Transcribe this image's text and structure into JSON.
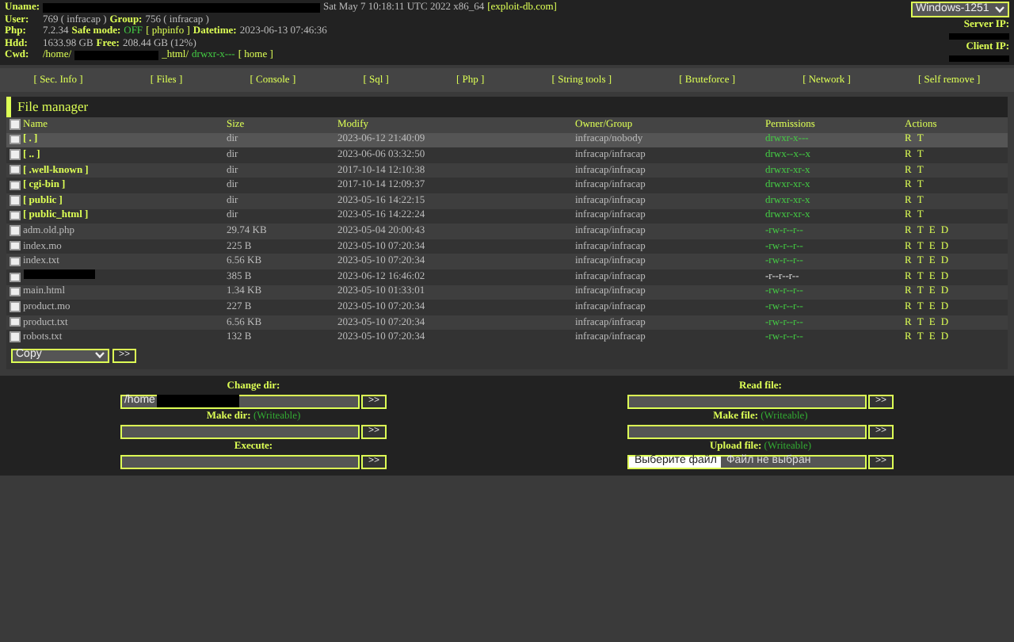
{
  "header": {
    "lines": [
      {
        "label": "Uname:",
        "parts": [
          {
            "kind": "redacted"
          },
          {
            "kind": "text",
            "text": "Sat May 7 10:18:11 UTC 2022 x86_64"
          },
          {
            "kind": "link",
            "text": "[exploit-db.com]"
          }
        ]
      },
      {
        "label": "User:",
        "parts": [
          {
            "kind": "text",
            "text": "769 ( infracap )"
          },
          {
            "kind": "label",
            "text": "Group:"
          },
          {
            "kind": "text",
            "text": "756 ( infracap )"
          }
        ]
      },
      {
        "label": "Php:",
        "parts": [
          {
            "kind": "text",
            "text": "7.2.34"
          },
          {
            "kind": "label",
            "text": "Safe mode:"
          },
          {
            "kind": "ok",
            "text": "OFF"
          },
          {
            "kind": "link",
            "text": "[ phpinfo ]"
          },
          {
            "kind": "label",
            "text": "Datetime:"
          },
          {
            "kind": "text",
            "text": "2023-06-13 07:46:36"
          }
        ]
      },
      {
        "label": "Hdd:",
        "parts": [
          {
            "kind": "text",
            "text": "1633.98 GB"
          },
          {
            "kind": "label",
            "text": "Free:"
          },
          {
            "kind": "text",
            "text": "208.44 GB (12%)"
          }
        ]
      },
      {
        "label": "Cwd:",
        "parts": [
          {
            "kind": "link",
            "text": "/home/"
          },
          {
            "kind": "redacted"
          },
          {
            "kind": "link",
            "text": "_html/"
          },
          {
            "kind": "ok",
            "text": "drwxr-x---"
          },
          {
            "kind": "link",
            "text": "[ home ]"
          }
        ]
      }
    ],
    "charset": "Windows-1251",
    "server_ip_label": "Server IP:",
    "client_ip_label": "Client IP:"
  },
  "nav": [
    "[ Sec. Info ]",
    "[ Files ]",
    "[ Console ]",
    "[ Sql ]",
    "[ Php ]",
    "[ String tools ]",
    "[ Bruteforce ]",
    "[ Network ]",
    "[ Self remove ]"
  ],
  "file_manager": {
    "title": "File manager",
    "select_all_checked": false,
    "columns": [
      "Name",
      "Size",
      "Modify",
      "Owner/Group",
      "Permissions",
      "Actions"
    ],
    "rows": [
      {
        "kind": "dir",
        "name": "[ . ]",
        "size": "dir",
        "modify": "2023-06-12 21:40:09",
        "owner": "infracap/nobody",
        "perms": "drwxr-x---",
        "writable": true,
        "actions": "R T",
        "checked": false,
        "highlighted": true
      },
      {
        "kind": "dir",
        "name": "[ .. ]",
        "size": "dir",
        "modify": "2023-06-06 03:32:50",
        "owner": "infracap/infracap",
        "perms": "drwx--x--x",
        "writable": true,
        "actions": "R T",
        "checked": false,
        "highlighted": false
      },
      {
        "kind": "dir",
        "name": "[ .well-known ]",
        "size": "dir",
        "modify": "2017-10-14 12:10:38",
        "owner": "infracap/infracap",
        "perms": "drwxr-xr-x",
        "writable": true,
        "actions": "R T",
        "checked": false,
        "highlighted": false
      },
      {
        "kind": "dir",
        "name": "[ cgi-bin ]",
        "size": "dir",
        "modify": "2017-10-14 12:09:37",
        "owner": "infracap/infracap",
        "perms": "drwxr-xr-x",
        "writable": true,
        "actions": "R T",
        "checked": false,
        "highlighted": false
      },
      {
        "kind": "dir",
        "name": "[ public ]",
        "size": "dir",
        "modify": "2023-05-16 14:22:15",
        "owner": "infracap/infracap",
        "perms": "drwxr-xr-x",
        "writable": true,
        "actions": "R T",
        "checked": false,
        "highlighted": false
      },
      {
        "kind": "dir",
        "name": "[ public_html ]",
        "size": "dir",
        "modify": "2023-05-16 14:22:24",
        "owner": "infracap/infracap",
        "perms": "drwxr-xr-x",
        "writable": true,
        "actions": "R T",
        "checked": false,
        "highlighted": false
      },
      {
        "kind": "file",
        "name": "adm.old.php",
        "size": "29.74 KB",
        "modify": "2023-05-04 20:00:43",
        "owner": "infracap/infracap",
        "perms": "-rw-r--r--",
        "writable": true,
        "actions": "R T E D",
        "checked": false,
        "highlighted": false
      },
      {
        "kind": "file",
        "name": "index.mo",
        "size": "225 B",
        "modify": "2023-05-10 07:20:34",
        "owner": "infracap/infracap",
        "perms": "-rw-r--r--",
        "writable": true,
        "actions": "R T E D",
        "checked": false,
        "highlighted": false
      },
      {
        "kind": "file",
        "name": "index.txt",
        "size": "6.56 KB",
        "modify": "2023-05-10 07:20:34",
        "owner": "infracap/infracap",
        "perms": "-rw-r--r--",
        "writable": true,
        "actions": "R T E D",
        "checked": false,
        "highlighted": false
      },
      {
        "kind": "redacted",
        "size": "385 B",
        "modify": "2023-06-12 16:46:02",
        "owner": "infracap/infracap",
        "perms": "-r--r--r--",
        "writable": false,
        "actions": "R T E D",
        "checked": false,
        "highlighted": false
      },
      {
        "kind": "file",
        "name": "main.html",
        "size": "1.34 KB",
        "modify": "2023-05-10 01:33:01",
        "owner": "infracap/infracap",
        "perms": "-rw-r--r--",
        "writable": true,
        "actions": "R T E D",
        "checked": false,
        "highlighted": false
      },
      {
        "kind": "file",
        "name": "product.mo",
        "size": "227 B",
        "modify": "2023-05-10 07:20:34",
        "owner": "infracap/infracap",
        "perms": "-rw-r--r--",
        "writable": true,
        "actions": "R T E D",
        "checked": false,
        "highlighted": false
      },
      {
        "kind": "file",
        "name": "product.txt",
        "size": "6.56 KB",
        "modify": "2023-05-10 07:20:34",
        "owner": "infracap/infracap",
        "perms": "-rw-r--r--",
        "writable": true,
        "actions": "R T E D",
        "checked": false,
        "highlighted": false
      },
      {
        "kind": "file",
        "name": "robots.txt",
        "size": "132 B",
        "modify": "2023-05-10 07:20:34",
        "owner": "infracap/infracap",
        "perms": "-rw-r--r--",
        "writable": true,
        "actions": "R T E D",
        "checked": false,
        "highlighted": false
      }
    ],
    "bulk_action": "Copy",
    "go": ">>"
  },
  "forms": [
    [
      {
        "label": "Change dir:",
        "kind": "text",
        "value": "/home",
        "redacted": true,
        "go": ">>"
      },
      {
        "label": "Make dir:",
        "note": "(Writeable)",
        "kind": "text",
        "go": ">>"
      },
      {
        "label": "Execute:",
        "kind": "text",
        "go": ">>"
      }
    ],
    [
      {
        "label": "Read file:",
        "kind": "text",
        "go": ">>"
      },
      {
        "label": "Make file:",
        "note": "(Writeable)",
        "kind": "text",
        "go": ">>"
      },
      {
        "label": "Upload file:",
        "note": "(Writeable)",
        "kind": "file",
        "button": "Выберите файл",
        "status": "Файл не выбран",
        "go": ">>"
      }
    ]
  ]
}
